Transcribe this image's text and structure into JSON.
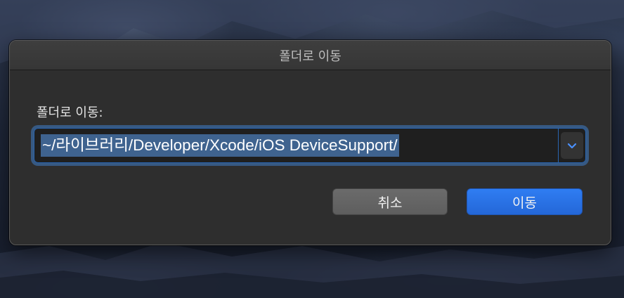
{
  "dialog": {
    "title": "폴더로 이동",
    "prompt_label": "폴더로 이동:",
    "path_value": "~/라이브러리/Developer/Xcode/iOS DeviceSupport/",
    "dropdown_icon": "chevron-down-icon",
    "cancel_label": "취소",
    "go_label": "이동"
  },
  "colors": {
    "accent": "#2a6fde",
    "selection": "#3f638f",
    "dialog_bg": "#2e2e2e"
  }
}
